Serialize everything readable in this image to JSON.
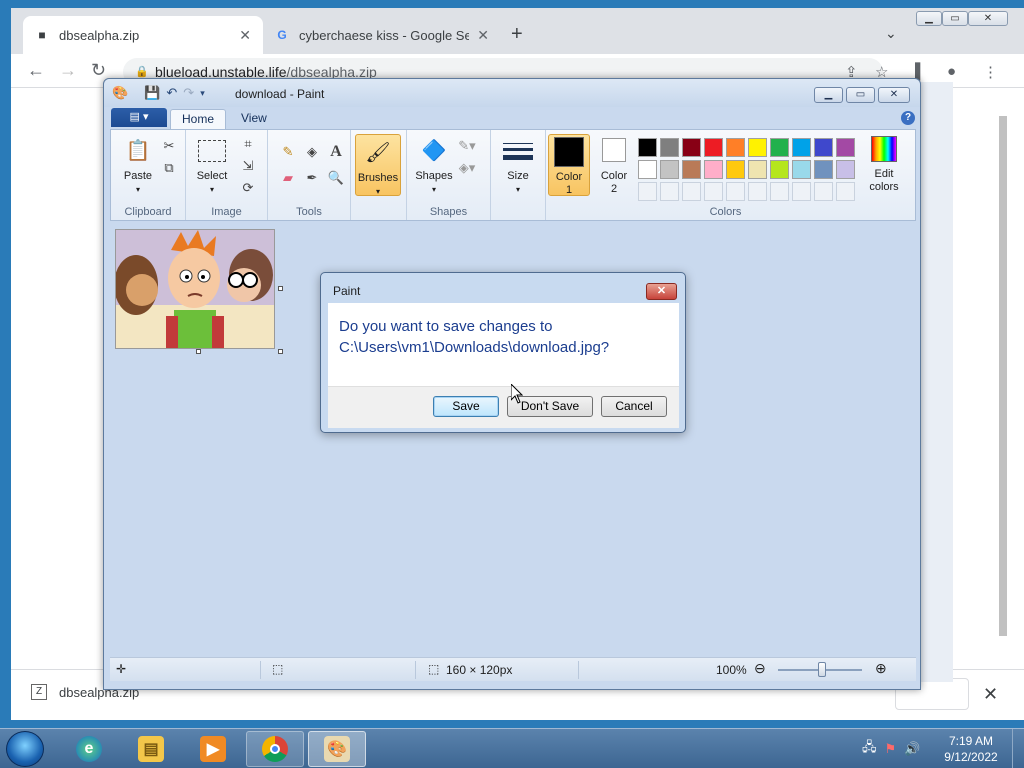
{
  "browser": {
    "tabs": [
      {
        "title": "dbsealpha.zip",
        "active": true
      },
      {
        "title": "cyberchaese kiss - Google Search",
        "active": false
      }
    ],
    "url_host": "blueload.unstable.life",
    "url_path": "/dbsealpha.zip",
    "download": {
      "filename": "dbsealpha.zip"
    }
  },
  "paint": {
    "window_title": "download - Paint",
    "tabs": [
      "Home",
      "View"
    ],
    "groups": {
      "clipboard": {
        "label": "Clipboard",
        "paste": "Paste"
      },
      "image": {
        "label": "Image",
        "select": "Select"
      },
      "tools": {
        "label": "Tools"
      },
      "brushes": {
        "label": "Brushes"
      },
      "shapes": {
        "label": "Shapes",
        "shapes_btn": "Shapes"
      },
      "size": {
        "label": "Size"
      },
      "colors": {
        "label": "Colors",
        "color1": "Color",
        "color1_num": "1",
        "color2": "Color",
        "color2_num": "2",
        "edit": "Edit",
        "edit2": "colors"
      }
    },
    "palette_row1": [
      "#000000",
      "#7f7f7f",
      "#880015",
      "#ed1c24",
      "#ff7f27",
      "#fff200",
      "#22b14c",
      "#00a2e8",
      "#3f48cc",
      "#a349a4"
    ],
    "palette_row2": [
      "#ffffff",
      "#c3c3c3",
      "#b97a57",
      "#ffaec9",
      "#ffc90e",
      "#efe4b0",
      "#b5e61d",
      "#99d9ea",
      "#7092be",
      "#c8bfe7"
    ],
    "color1": "#000000",
    "color2": "#ffffff",
    "status": {
      "image_size": "160 × 120px",
      "zoom": "100%"
    }
  },
  "dialog": {
    "title": "Paint",
    "message_line1": "Do you want to save changes to",
    "message_line2": "C:\\Users\\vm1\\Downloads\\download.jpg?",
    "buttons": {
      "save": "Save",
      "dont_save": "Don't Save",
      "cancel": "Cancel"
    }
  },
  "taskbar": {
    "time": "7:19 AM",
    "date": "9/12/2022"
  }
}
